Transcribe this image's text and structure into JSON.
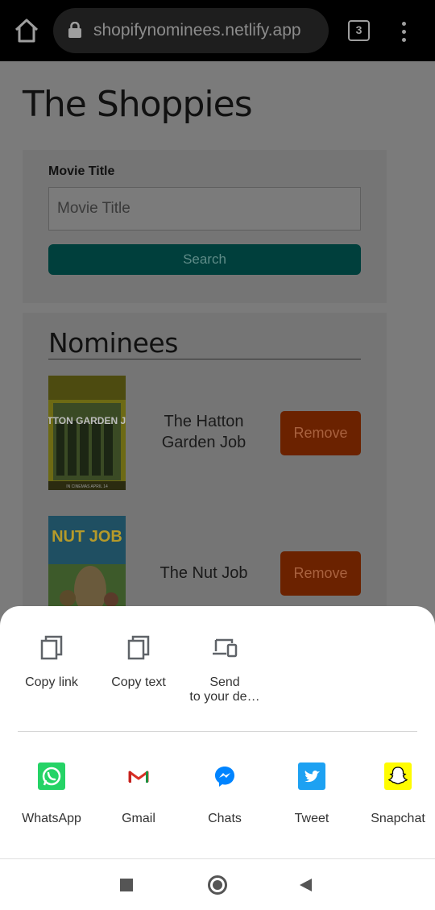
{
  "browser": {
    "url": "shopifynominees.netlify.app",
    "tab_count": "3"
  },
  "page": {
    "title": "The Shoppies",
    "search": {
      "label": "Movie Title",
      "placeholder": "Movie Title",
      "button_label": "Search"
    },
    "nominees": {
      "heading": "Nominees",
      "items": [
        {
          "title": "The Hatton Garden Job",
          "poster_text": "HATTON GARDEN JOB",
          "poster_footer": "IN CINEMAS APRIL 14",
          "button_label": "Remove"
        },
        {
          "title": "The Nut Job",
          "poster_text": "NUT JOB",
          "button_label": "Remove"
        }
      ]
    }
  },
  "share_sheet": {
    "actions": [
      {
        "label": "Copy link",
        "icon": "copy-icon"
      },
      {
        "label": "Copy text",
        "icon": "copy-icon"
      },
      {
        "label": "Send\nto your de…",
        "icon": "devices-icon"
      }
    ],
    "apps": [
      {
        "label": "WhatsApp",
        "icon": "whatsapp-icon",
        "color": "#25d366"
      },
      {
        "label": "Gmail",
        "icon": "gmail-icon",
        "color": "#d93025"
      },
      {
        "label": "Chats",
        "icon": "messenger-icon",
        "color": "#0084ff"
      },
      {
        "label": "Tweet",
        "icon": "twitter-icon",
        "color": "#1da1f2"
      },
      {
        "label": "Snapchat",
        "icon": "snapchat-icon",
        "color": "#fffc00"
      }
    ]
  },
  "nav_bar": {
    "buttons": [
      "recents",
      "home",
      "back"
    ]
  }
}
